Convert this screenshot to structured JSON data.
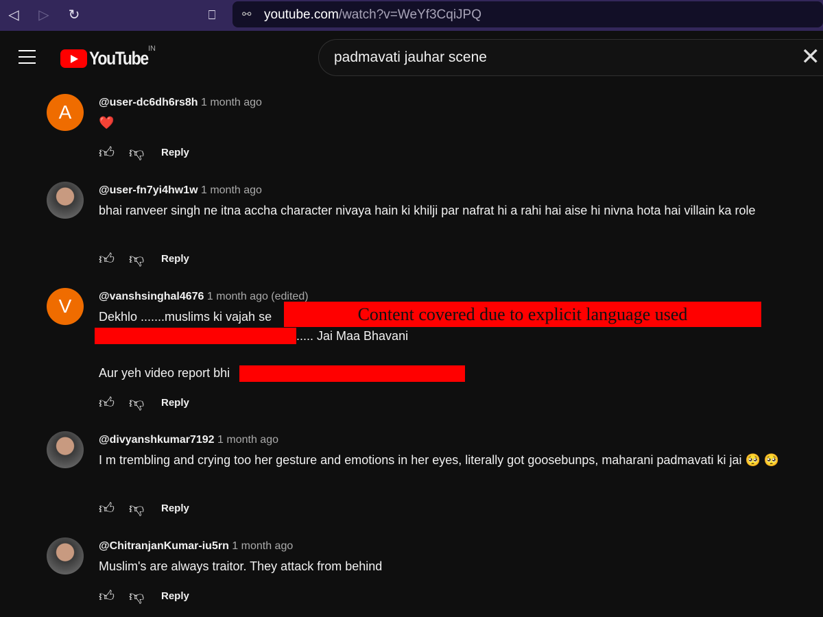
{
  "browser": {
    "url_domain": "youtube.com",
    "url_path": "/watch?v=WeYf3CqiJPQ"
  },
  "header": {
    "logo": "YouTube",
    "country": "IN",
    "search_query": "padmavati jauhar scene"
  },
  "reply_label": "Reply",
  "censor": {
    "label": "Content covered due to explicit language used",
    "color": "#ff0000"
  },
  "comments": [
    {
      "avatar": "A",
      "user": "@user-dc6dh6rs8h",
      "time": "1 month ago",
      "text": "❤️"
    },
    {
      "avatar": "",
      "user": "@user-fn7yi4hw1w",
      "time": "1 month ago",
      "text": "bhai ranveer singh ne itna accha character nivaya hain ki khilji par nafrat hi a rahi hai aise hi nivna hota hai villain ka role"
    },
    {
      "avatar": "V",
      "user": "@vanshsinghal4676",
      "time": "1 month ago (edited)",
      "line1": "Dekhlo .......muslims ki vajah se",
      "line2": "..... Jai Maa Bhavani",
      "line3": "Aur yeh video report bhi"
    },
    {
      "avatar": "",
      "user": "@divyanshkumar7192",
      "time": "1 month ago",
      "text": "I m trembling and crying too her gesture and emotions in her eyes, literally got goosebunps, maharani padmavati ki jai 🥺 🥺"
    },
    {
      "avatar": "",
      "user": "@ChitranjanKumar-iu5rn",
      "time": "1 month ago",
      "text": "Muslim's are always traitor. They attack from behind"
    }
  ]
}
